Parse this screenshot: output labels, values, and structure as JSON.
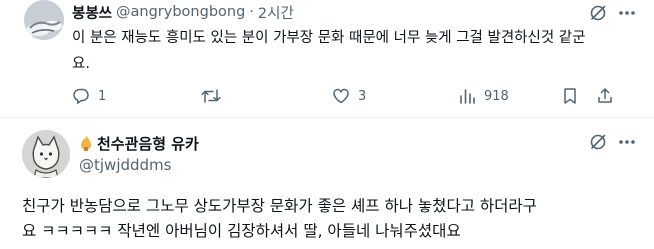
{
  "reply": {
    "display_name": "봉봉쓰",
    "handle": "@angrybongbong",
    "separator": "·",
    "time": "2시간",
    "text_line1": "이 분은 재능도 흥미도 있는 분이 가부장 문화 때문에 너무 늦게 그걸 발견하신것 같군",
    "text_line2": "요.",
    "actions": {
      "reply_count": "1",
      "retweet_count": "",
      "like_count": "3",
      "view_count": "918"
    }
  },
  "main": {
    "display_name": "천수관음형 유카",
    "handle": "@tjwjdddms",
    "text_line1": "친구가 반농담으로 그노무 상도가부장 문화가 좋은 셰프 하나 놓쳤다고 하더라구",
    "text_line2": "요 ㅋㅋㅋㅋㅋ 작년엔 아버님이 김장하셔서 딸, 아들네 나눠주셨대요"
  },
  "colors": {
    "text": "#0f1419",
    "muted": "#536471",
    "divider": "#eff3f4"
  }
}
